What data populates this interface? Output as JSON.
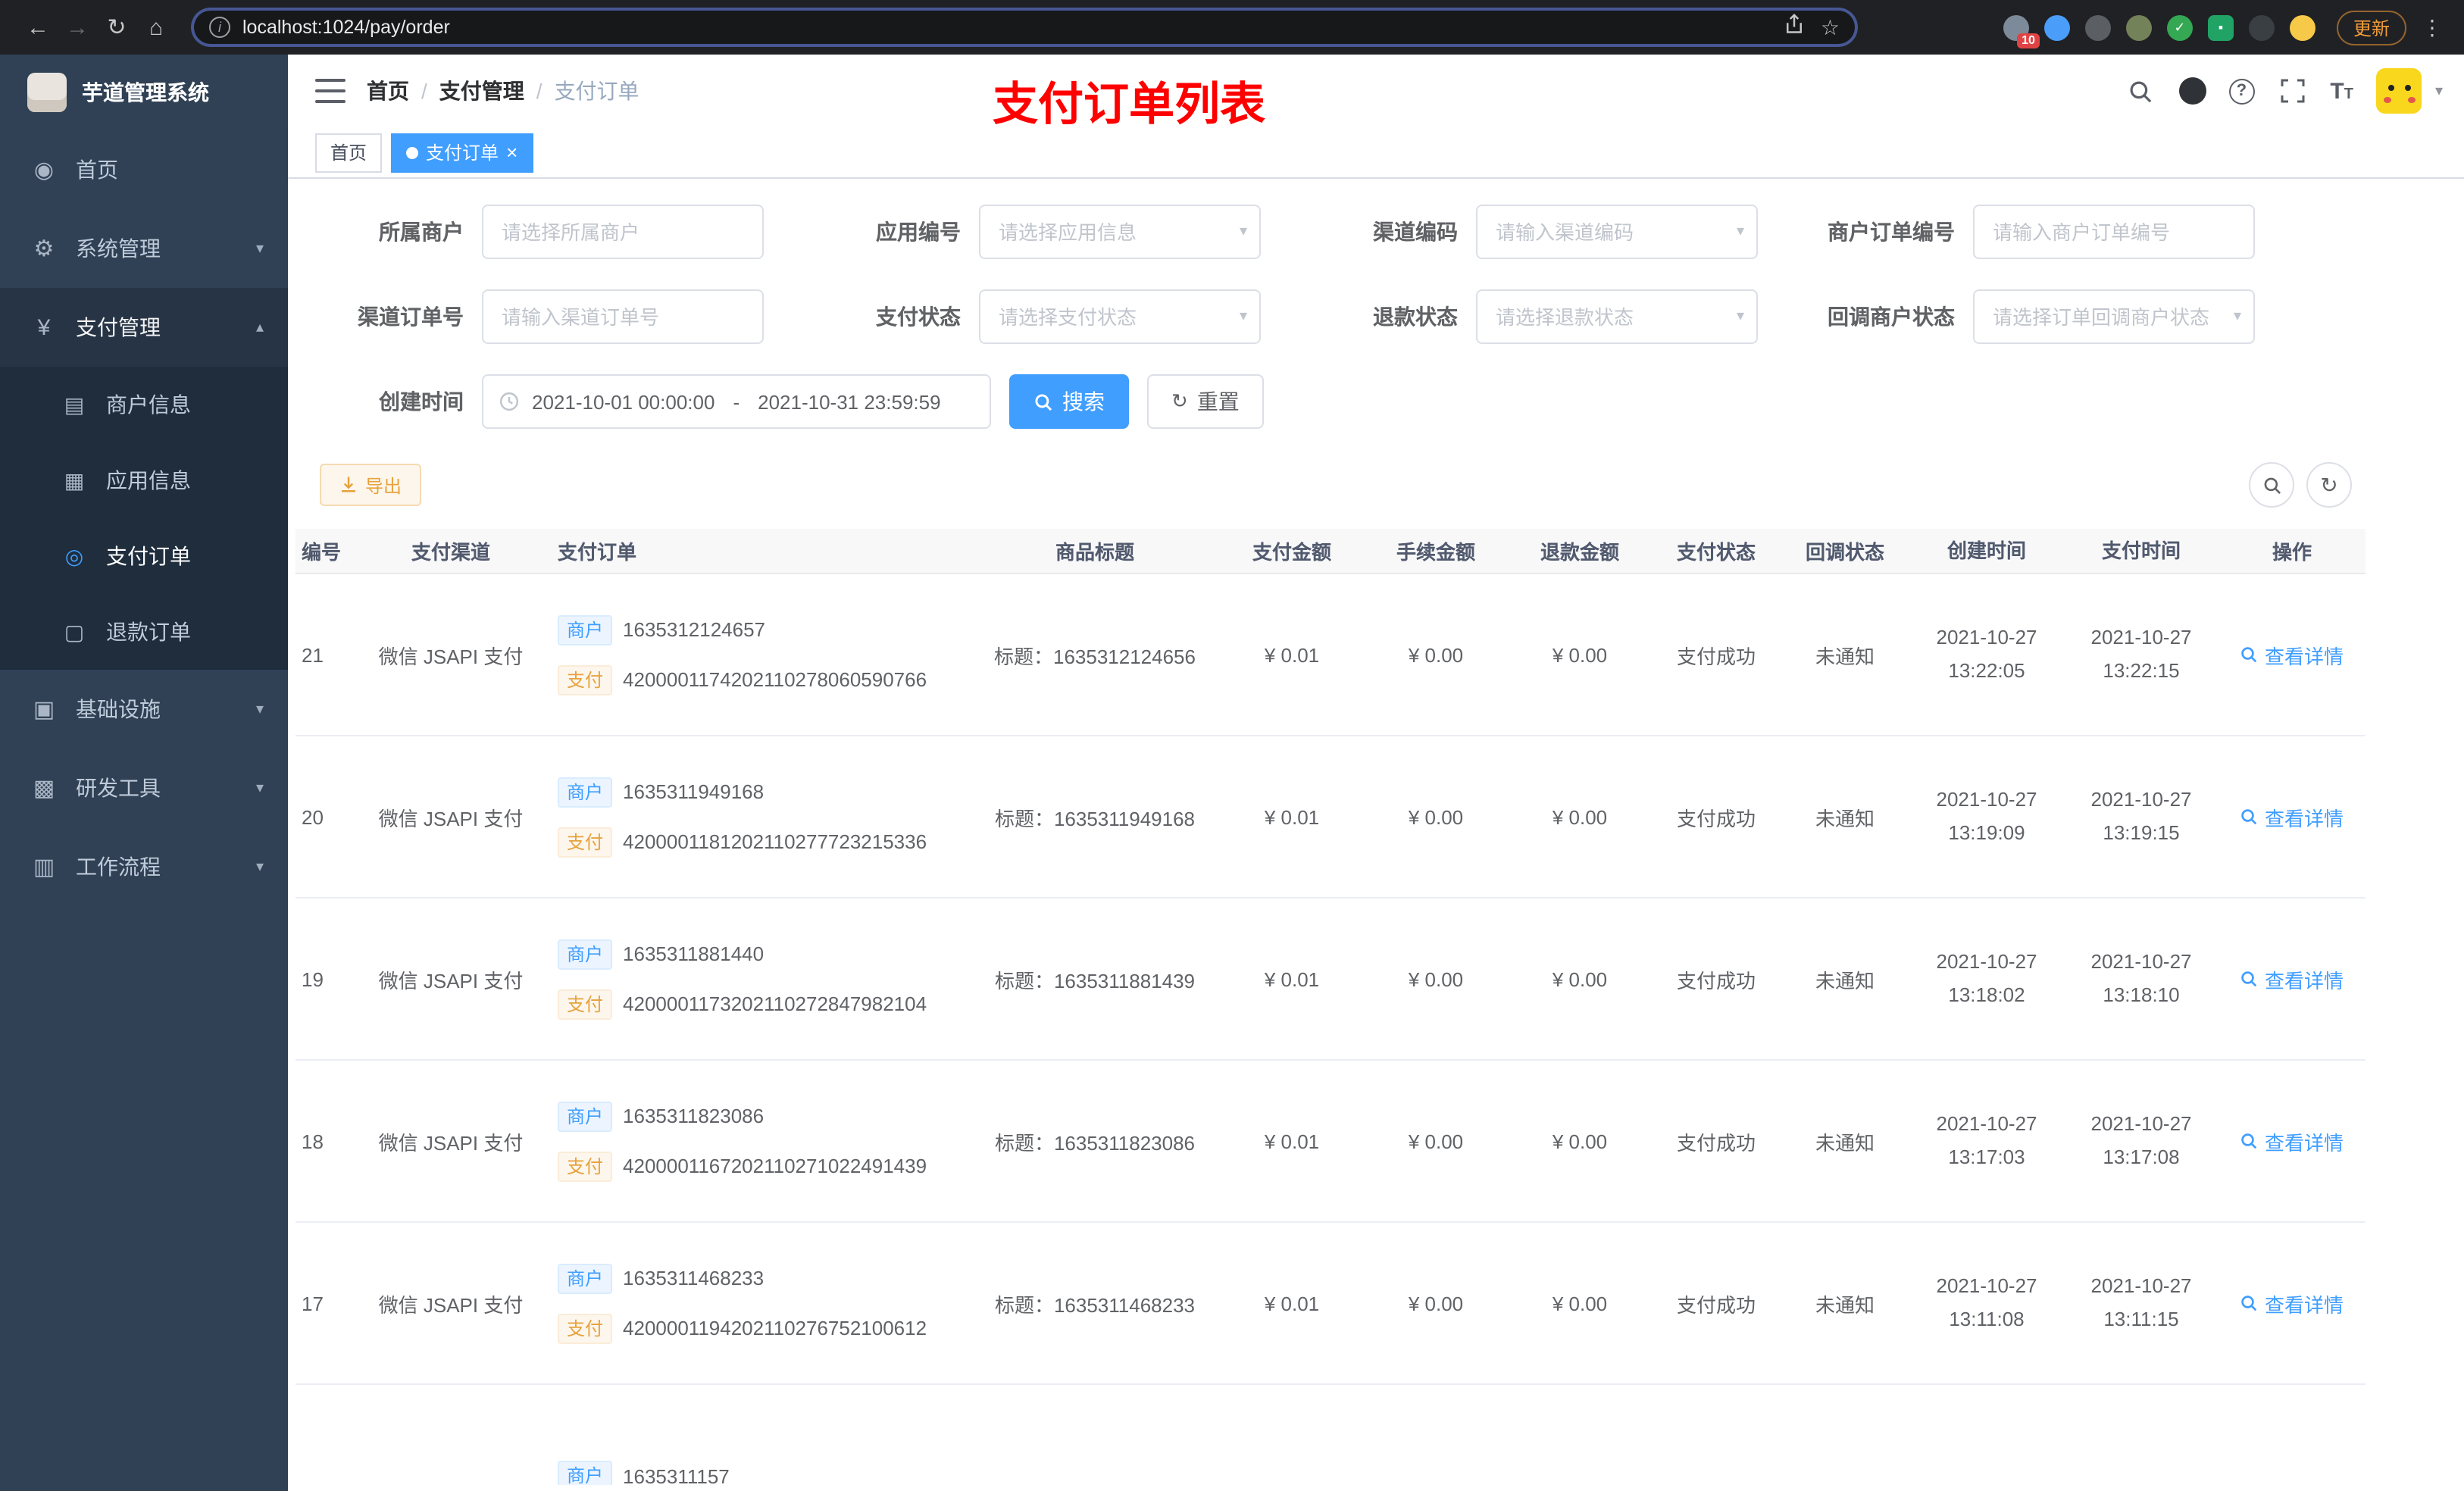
{
  "browser": {
    "url": "localhost:1024/pay/order",
    "update_label": "更新",
    "extension_badge": "10"
  },
  "sidebar": {
    "logo_title": "芋道管理系统",
    "home": "首页",
    "system": "系统管理",
    "pay": "支付管理",
    "merchant_info": "商户信息",
    "app_info": "应用信息",
    "pay_order": "支付订单",
    "refund_order": "退款订单",
    "infra": "基础设施",
    "dev_tools": "研发工具",
    "workflow": "工作流程"
  },
  "header": {
    "breadcrumb_home": "首页",
    "breadcrumb_section": "支付管理",
    "breadcrumb_current": "支付订单",
    "sep": "/",
    "page_title": "支付订单列表"
  },
  "tabs": {
    "home": "首页",
    "current": "支付订单"
  },
  "filters": {
    "merchant": {
      "label": "所属商户",
      "placeholder": "请选择所属商户"
    },
    "app_no": {
      "label": "应用编号",
      "placeholder": "请选择应用信息"
    },
    "channel_code": {
      "label": "渠道编码",
      "placeholder": "请输入渠道编码"
    },
    "merchant_order_no": {
      "label": "商户订单编号",
      "placeholder": "请输入商户订单编号"
    },
    "channel_order_no": {
      "label": "渠道订单号",
      "placeholder": "请输入渠道订单号"
    },
    "pay_status": {
      "label": "支付状态",
      "placeholder": "请选择支付状态"
    },
    "refund_status": {
      "label": "退款状态",
      "placeholder": "请选择退款状态"
    },
    "notify_status": {
      "label": "回调商户状态",
      "placeholder": "请选择订单回调商户状态"
    },
    "create_time": {
      "label": "创建时间",
      "start": "2021-10-01 00:00:00",
      "separator": "-",
      "end": "2021-10-31 23:59:59"
    },
    "search": "搜索",
    "reset": "重置"
  },
  "toolbar": {
    "export_label": "导出"
  },
  "table": {
    "columns": {
      "id": "编号",
      "channel": "支付渠道",
      "order": "支付订单",
      "title": "商品标题",
      "amount": "支付金额",
      "fee": "手续金额",
      "refund": "退款金额",
      "status": "支付状态",
      "notify": "回调状态",
      "create_time": "创建时间",
      "pay_time": "支付时间",
      "action": "操作"
    },
    "merchant_tag": "商户",
    "pay_tag": "支付",
    "rows": [
      {
        "id": "21",
        "channel": "微信 JSAPI 支付",
        "merchant_no": "1635312124657",
        "pay_no": "4200001174202110278060590766",
        "title": "标题：1635312124656",
        "amount": "¥ 0.01",
        "fee": "¥ 0.00",
        "refund": "¥ 0.00",
        "status": "支付成功",
        "notify": "未通知",
        "create_date": "2021-10-27",
        "create_clock": "13:22:05",
        "pay_date": "2021-10-27",
        "pay_clock": "13:22:15",
        "action": "查看详情"
      },
      {
        "id": "20",
        "channel": "微信 JSAPI 支付",
        "merchant_no": "1635311949168",
        "pay_no": "4200001181202110277723215336",
        "title": "标题：1635311949168",
        "amount": "¥ 0.01",
        "fee": "¥ 0.00",
        "refund": "¥ 0.00",
        "status": "支付成功",
        "notify": "未通知",
        "create_date": "2021-10-27",
        "create_clock": "13:19:09",
        "pay_date": "2021-10-27",
        "pay_clock": "13:19:15",
        "action": "查看详情"
      },
      {
        "id": "19",
        "channel": "微信 JSAPI 支付",
        "merchant_no": "1635311881440",
        "pay_no": "4200001173202110272847982104",
        "title": "标题：1635311881439",
        "amount": "¥ 0.01",
        "fee": "¥ 0.00",
        "refund": "¥ 0.00",
        "status": "支付成功",
        "notify": "未通知",
        "create_date": "2021-10-27",
        "create_clock": "13:18:02",
        "pay_date": "2021-10-27",
        "pay_clock": "13:18:10",
        "action": "查看详情"
      },
      {
        "id": "18",
        "channel": "微信 JSAPI 支付",
        "merchant_no": "1635311823086",
        "pay_no": "4200001167202110271022491439",
        "title": "标题：1635311823086",
        "amount": "¥ 0.01",
        "fee": "¥ 0.00",
        "refund": "¥ 0.00",
        "status": "支付成功",
        "notify": "未通知",
        "create_date": "2021-10-27",
        "create_clock": "13:17:03",
        "pay_date": "2021-10-27",
        "pay_clock": "13:17:08",
        "action": "查看详情"
      },
      {
        "id": "17",
        "channel": "微信 JSAPI 支付",
        "merchant_no": "1635311468233",
        "pay_no": "4200001194202110276752100612",
        "title": "标题：1635311468233",
        "amount": "¥ 0.01",
        "fee": "¥ 0.00",
        "refund": "¥ 0.00",
        "status": "支付成功",
        "notify": "未通知",
        "create_date": "2021-10-27",
        "create_clock": "13:11:08",
        "pay_date": "2021-10-27",
        "pay_clock": "13:11:15",
        "action": "查看详情"
      },
      {
        "id": "",
        "channel": "",
        "merchant_no": "1635311157",
        "pay_no": "",
        "title": "",
        "amount": "",
        "fee": "",
        "refund": "",
        "status": "",
        "notify": "",
        "create_date": "",
        "create_clock": "",
        "pay_date": "",
        "pay_clock": "",
        "action": ""
      }
    ]
  }
}
